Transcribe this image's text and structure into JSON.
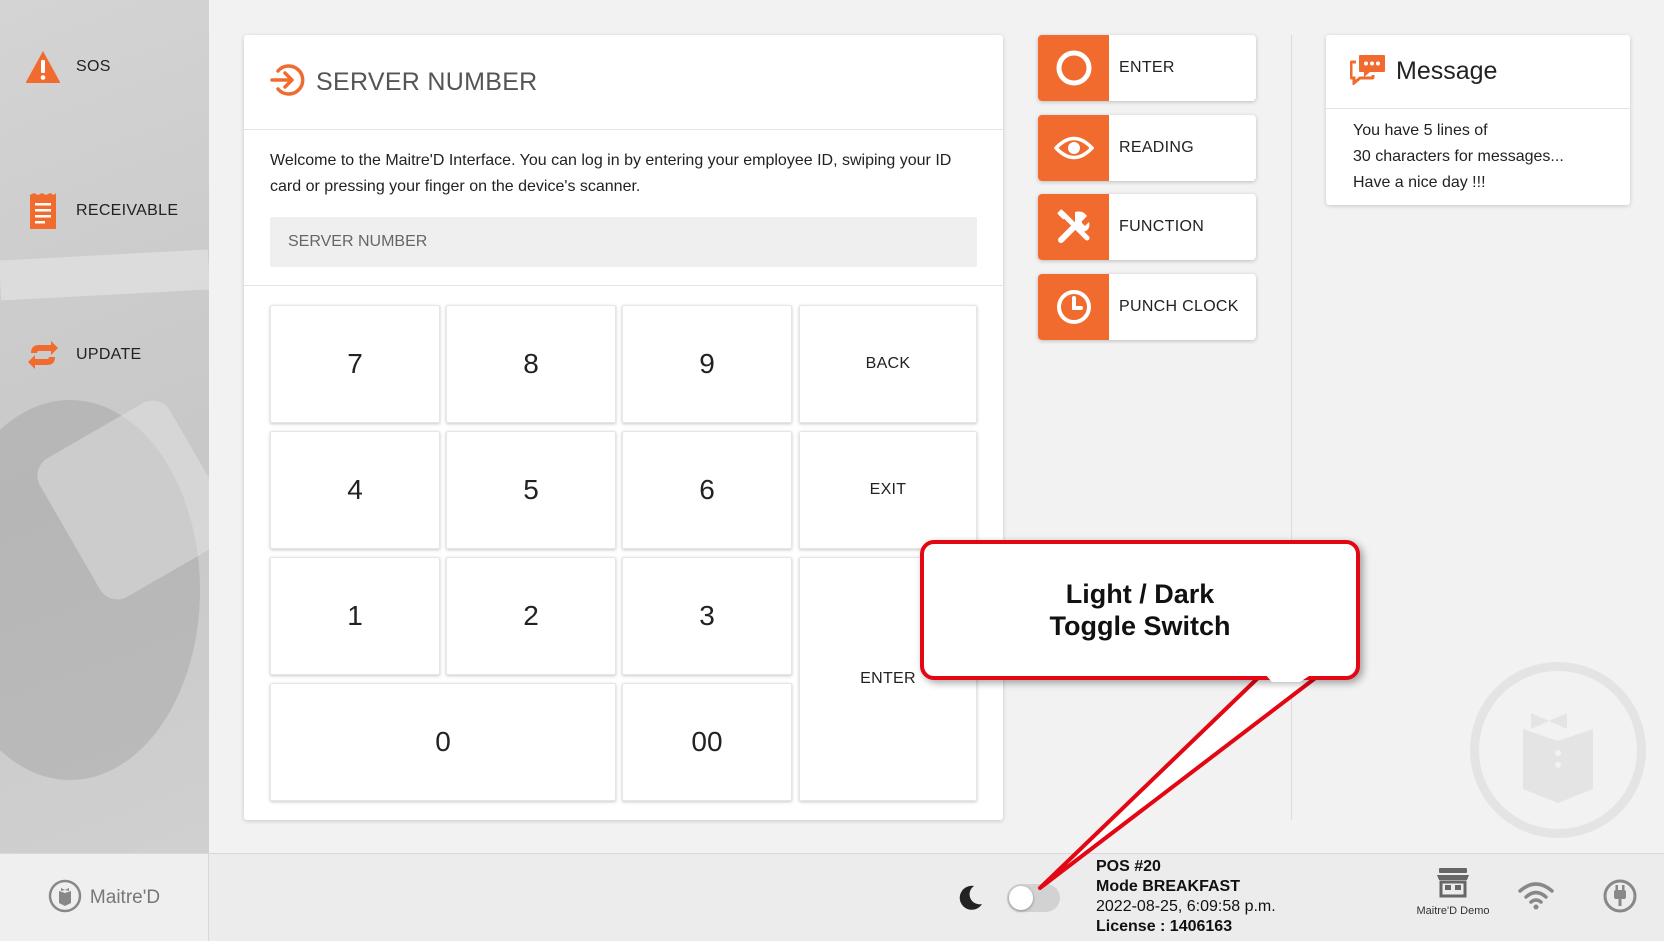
{
  "sidebar": {
    "items": [
      {
        "label": "SOS",
        "icon": "warning-icon"
      },
      {
        "label": "RECEIVABLE",
        "icon": "receipt-icon"
      },
      {
        "label": "UPDATE",
        "icon": "sync-icon"
      }
    ]
  },
  "login": {
    "title": "SERVER NUMBER",
    "welcome": "Welcome to the Maitre'D Interface. You can log in by entering your employee ID, swiping your ID card or pressing your finger on the device's scanner.",
    "placeholder": "SERVER NUMBER",
    "keys": {
      "k7": "7",
      "k8": "8",
      "k9": "9",
      "back": "BACK",
      "k4": "4",
      "k5": "5",
      "k6": "6",
      "exit": "EXIT",
      "k1": "1",
      "k2": "2",
      "k3": "3",
      "enter": "ENTER",
      "k0": "0",
      "k00": "00"
    }
  },
  "actions": [
    {
      "label": "ENTER",
      "icon": "circle-icon"
    },
    {
      "label": "READING",
      "icon": "eye-icon"
    },
    {
      "label": "FUNCTION",
      "icon": "tools-icon"
    },
    {
      "label": "PUNCH CLOCK",
      "icon": "clock-icon"
    }
  ],
  "message": {
    "title": "Message",
    "lines": [
      "You have 5 lines of",
      "30 characters for messages...",
      "Have a nice day !!!"
    ]
  },
  "bottombar": {
    "brand": "Maitre'D",
    "pos": "POS #20",
    "mode": "Mode BREAKFAST",
    "datetime": "2022-08-25, 6:09:58 p.m.",
    "license": "License : 1406163",
    "demo_label": "Maitre'D Demo"
  },
  "callout": {
    "line1": "Light / Dark",
    "line2": "Toggle Switch"
  },
  "colors": {
    "accent": "#f26b2e",
    "callout_border": "#e30613"
  }
}
